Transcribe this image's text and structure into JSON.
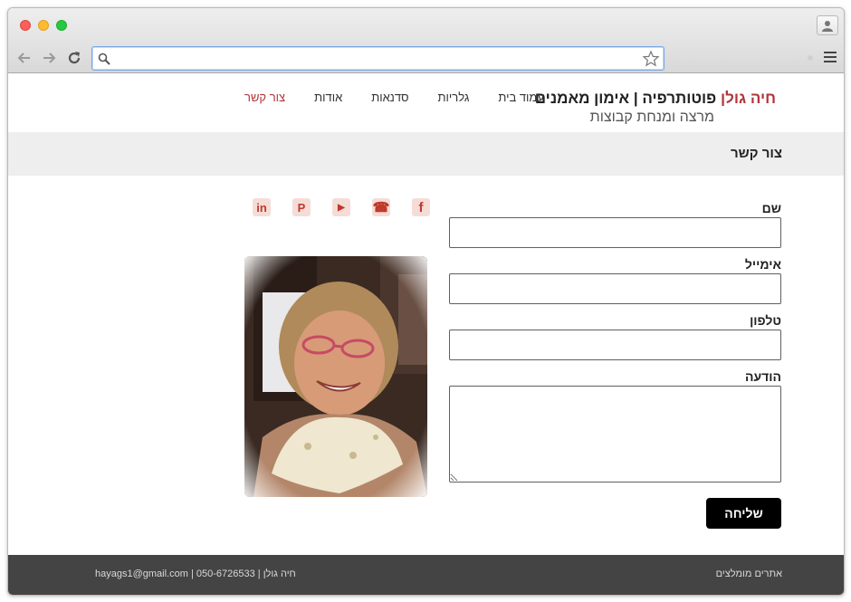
{
  "browser": {
    "url": "",
    "icons": {
      "back": "back-arrow-icon",
      "forward": "forward-arrow-icon",
      "reload": "reload-icon",
      "search": "search-icon",
      "bookmark": "star-icon",
      "menu": "hamburger-menu-icon",
      "profile": "profile-icon"
    }
  },
  "header": {
    "brand_name": "חיה גולן",
    "brand_tagline": "פוטותרפיה | אימון מאמנים",
    "brand_subtitle": "מרצה ומנחת קבוצות"
  },
  "nav": {
    "items": [
      {
        "label": "עמוד בית"
      },
      {
        "label": "גלריות"
      },
      {
        "label": "סדנאות"
      },
      {
        "label": "אודות"
      },
      {
        "label": "צור קשר"
      }
    ],
    "active_index": 4
  },
  "page_title": "צור קשר",
  "form": {
    "name_label": "שם",
    "email_label": "אימייל",
    "phone_label": "טלפון",
    "message_label": "הודעה",
    "name_value": "",
    "email_value": "",
    "phone_value": "",
    "message_value": "",
    "submit_label": "שליחה"
  },
  "social": {
    "items": [
      {
        "icon": "linkedin-icon",
        "glyph": "in"
      },
      {
        "icon": "pinterest-icon",
        "glyph": "P"
      },
      {
        "icon": "youtube-icon",
        "glyph": "▶"
      },
      {
        "icon": "phone-icon",
        "glyph": "☎"
      },
      {
        "icon": "facebook-icon",
        "glyph": "f"
      }
    ]
  },
  "footer": {
    "recommended_sites": "אתרים מומלצים",
    "contact_line": "חיה גולן | 050-6726533 | hayags1@gmail.com"
  },
  "colors": {
    "accent": "#b3343a",
    "title_band": "#eeeeee",
    "footer_bg": "#444444",
    "button_bg": "#000000",
    "social_bg": "#f6dcd7",
    "social_fg": "#c0392b"
  }
}
